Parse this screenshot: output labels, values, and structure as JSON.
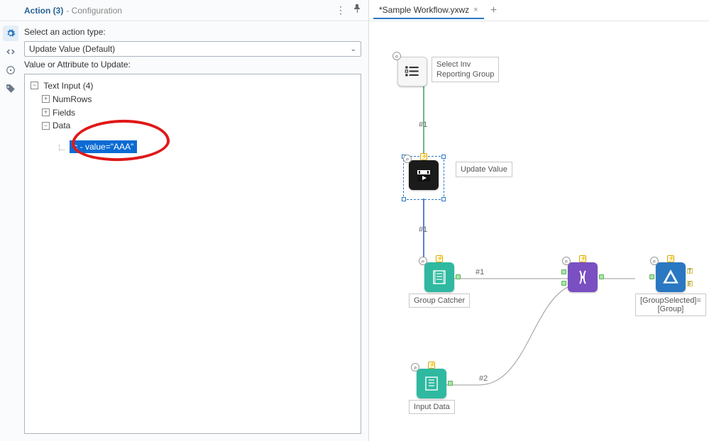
{
  "panel": {
    "title_main": "Action (3)",
    "title_sub": "- Configuration",
    "select_label": "Select an action type:",
    "select_value": "Update Value (Default)",
    "tree_label": "Value or Attribute to Update:",
    "tree": {
      "root": "Text Input (4)",
      "numrows": "NumRows",
      "fields": "Fields",
      "data": "Data",
      "selected": "c - value=\"AAA\""
    }
  },
  "tabs": {
    "active": "*Sample Workflow.yxwz"
  },
  "canvas": {
    "nodes": {
      "listbox": {
        "label1": "Select Inv",
        "label2": "Reporting Group"
      },
      "action": {
        "label": "Update Value"
      },
      "textinput1": {
        "label": "Group Catcher"
      },
      "textinput2": {
        "label": "Input Data"
      },
      "filter": {
        "label": "[GroupSelected]=\n[Group]"
      }
    },
    "wire_labels": {
      "w1": "#1",
      "w2": "#1",
      "w3": "#1",
      "w4": "#2"
    },
    "port_badges": {
      "t": "T",
      "f": "F"
    }
  }
}
